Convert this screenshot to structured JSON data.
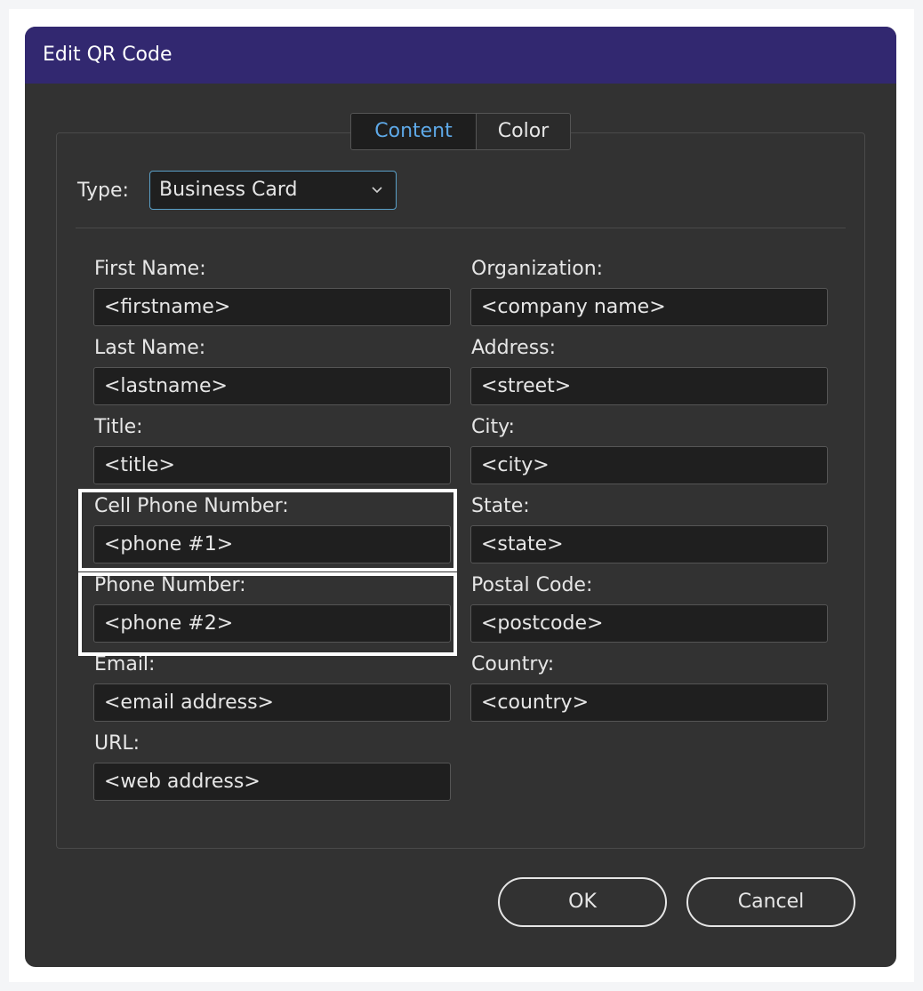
{
  "dialog": {
    "title": "Edit QR Code"
  },
  "tabs": [
    {
      "label": "Content",
      "active": true
    },
    {
      "label": "Color",
      "active": false
    }
  ],
  "type": {
    "label": "Type:",
    "value": "Business Card",
    "icon": "chevron-down-icon"
  },
  "fields_left": [
    {
      "label": "First Name:",
      "value": "<firstname>"
    },
    {
      "label": "Last Name:",
      "value": "<lastname>"
    },
    {
      "label": "Title:",
      "value": "<title>"
    },
    {
      "label": "Cell Phone Number:",
      "value": "<phone #1>"
    },
    {
      "label": "Phone Number:",
      "value": "<phone #2>"
    },
    {
      "label": "Email:",
      "value": "<email address>"
    },
    {
      "label": "URL:",
      "value": "<web address>"
    }
  ],
  "fields_right": [
    {
      "label": "Organization:",
      "value": "<company name>"
    },
    {
      "label": "Address:",
      "value": "<street>"
    },
    {
      "label": "City:",
      "value": "<city>"
    },
    {
      "label": "State:",
      "value": "<state>"
    },
    {
      "label": "Postal Code:",
      "value": "<postcode>"
    },
    {
      "label": "Country:",
      "value": "<country>"
    }
  ],
  "buttons": {
    "ok": "OK",
    "cancel": "Cancel"
  },
  "colors": {
    "titlebar": "#322870",
    "dialog_bg": "#323232",
    "active_tab_text": "#5ea9e8",
    "highlight": "#ffffff"
  }
}
